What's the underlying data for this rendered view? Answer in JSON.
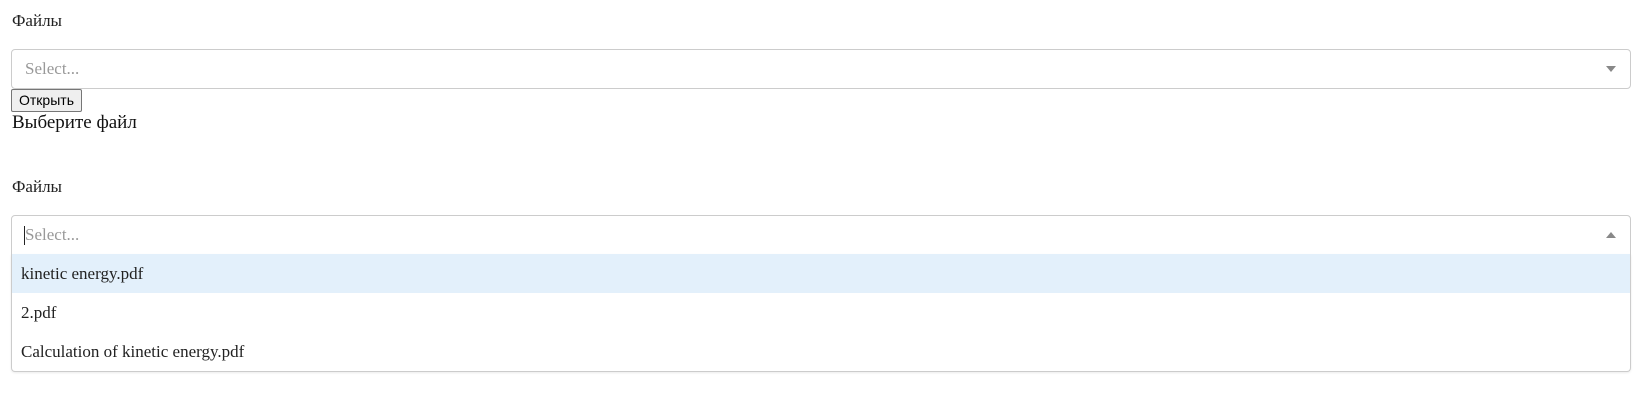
{
  "form1": {
    "label": "Файлы",
    "select_placeholder": "Select...",
    "open_button": "Открыть",
    "hint": "Выберите файл"
  },
  "form2": {
    "label": "Файлы",
    "select_placeholder": "Select...",
    "options": [
      "kinetic energy.pdf",
      "2.pdf",
      "Calculation of kinetic energy.pdf"
    ],
    "focused_option_index": 0
  },
  "colors": {
    "option_focus_bg": "#e3f0fb",
    "border": "#cccccc",
    "placeholder": "#999999"
  }
}
